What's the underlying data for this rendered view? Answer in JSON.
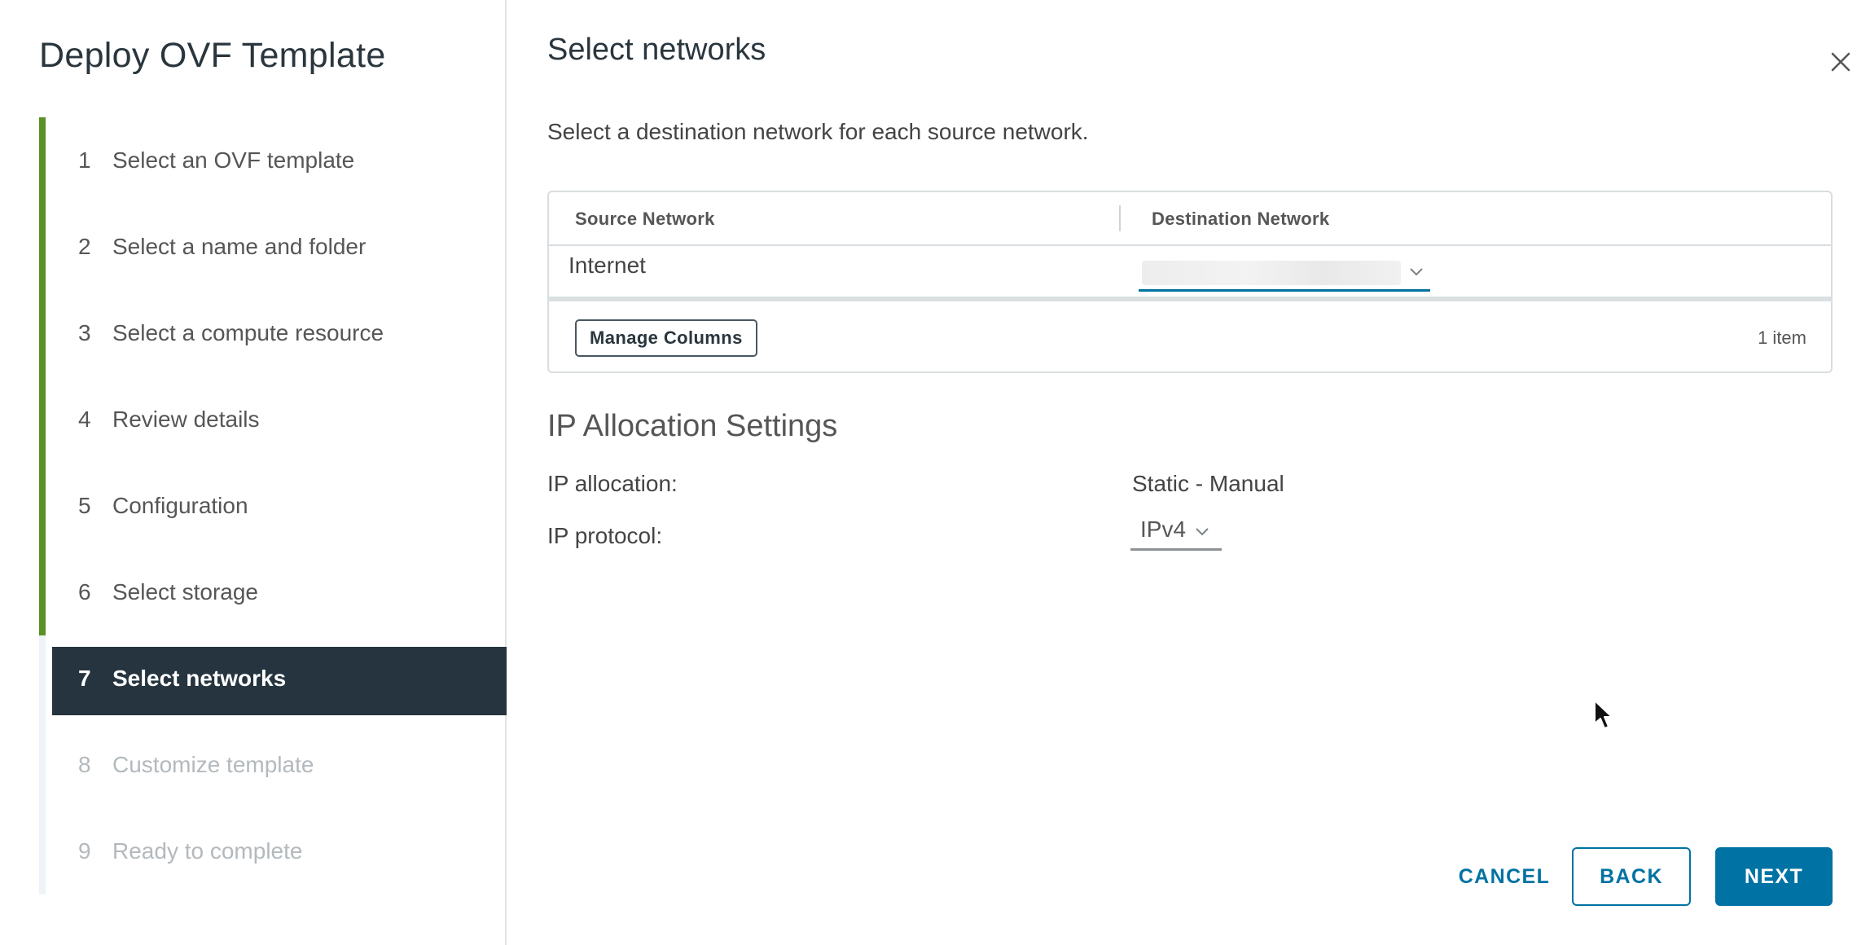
{
  "wizard": {
    "title": "Deploy OVF Template",
    "steps": [
      {
        "num": "1",
        "label": "Select an OVF template"
      },
      {
        "num": "2",
        "label": "Select a name and folder"
      },
      {
        "num": "3",
        "label": "Select a compute resource"
      },
      {
        "num": "4",
        "label": "Review details"
      },
      {
        "num": "5",
        "label": "Configuration"
      },
      {
        "num": "6",
        "label": "Select storage"
      },
      {
        "num": "7",
        "label": "Select networks"
      },
      {
        "num": "8",
        "label": "Customize template"
      },
      {
        "num": "9",
        "label": "Ready to complete"
      }
    ],
    "current_step": 7
  },
  "page": {
    "title": "Select networks",
    "description": "Select a destination network for each source network."
  },
  "grid": {
    "columns": [
      "Source Network",
      "Destination Network"
    ],
    "rows": [
      {
        "source": "Internet",
        "destination": ""
      }
    ],
    "manage_columns_label": "Manage Columns",
    "item_count": "1 item"
  },
  "ip_settings": {
    "heading": "IP Allocation Settings",
    "allocation_label": "IP allocation:",
    "allocation_value": "Static - Manual",
    "protocol_label": "IP protocol:",
    "protocol_value": "IPv4"
  },
  "footer": {
    "cancel_label": "CANCEL",
    "back_label": "BACK",
    "next_label": "NEXT"
  },
  "icons": {
    "close": "close-icon",
    "chevron": "chevron-down-icon",
    "cursor": "mouse-cursor-icon"
  },
  "colors": {
    "accent": "#0072a3",
    "completed_step_bar": "#5a9126",
    "current_step_bg": "#25343e"
  }
}
